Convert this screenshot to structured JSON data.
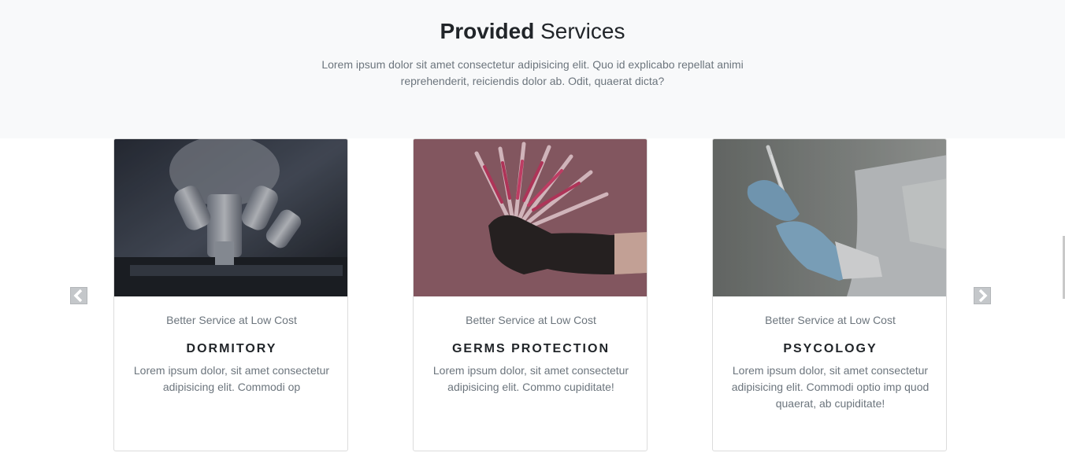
{
  "header": {
    "title_bold": "Provided",
    "title_rest": " Services",
    "subtitle": "Lorem ipsum dolor sit amet consectetur adipisicing elit. Quo id explicabo repellat animi reprehenderit, reiciendis dolor ab. Odit, quaerat dicta?"
  },
  "carousel": {
    "prev_icon": "chevron-left-icon",
    "next_icon": "chevron-right-icon",
    "cards": [
      {
        "tagline": "Better Service at Low Cost",
        "name": "DORMITORY",
        "description": "Lorem ipsum dolor, sit amet consectetur adipisicing elit. Commodi op",
        "image": "microscope-image"
      },
      {
        "tagline": "Better Service at Low Cost",
        "name": "GERMS PROTECTION",
        "description": "Lorem ipsum dolor, sit amet consectetur adipisicing elit. Commo cupiditate!",
        "image": "syringes-gloved-hand-image"
      },
      {
        "tagline": "Better Service at Low Cost",
        "name": "PSYCOLOGY",
        "description": "Lorem ipsum dolor, sit amet consectetur adipisicing elit. Commodi optio imp quod quaerat, ab cupiditate!",
        "image": "doctor-syringe-image"
      }
    ]
  },
  "colors": {
    "hero_bg": "#f8f9fa",
    "muted_text": "#6c757d",
    "heading_text": "#212529",
    "arrow_bg": "#c4c7ca"
  }
}
